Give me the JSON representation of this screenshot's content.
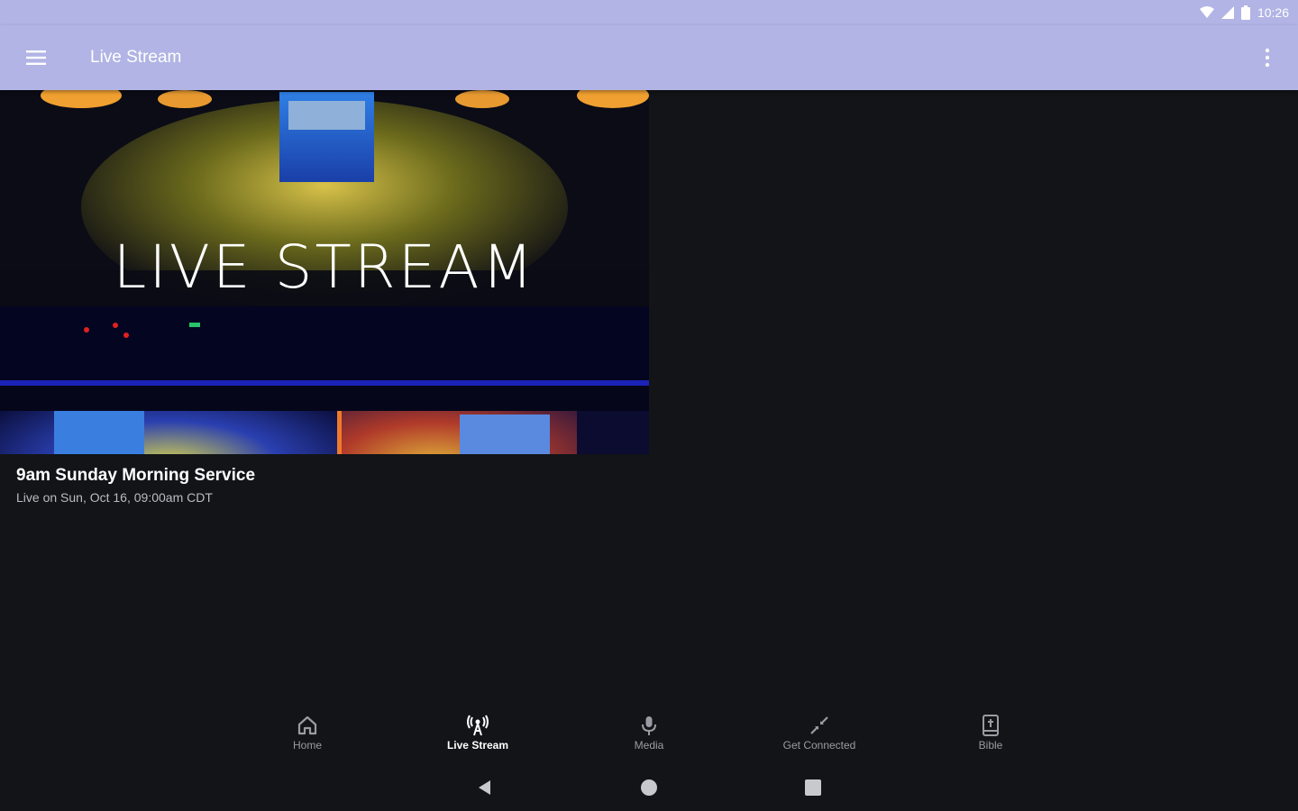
{
  "status_bar": {
    "time": "10:26",
    "icons": [
      "wifi-icon",
      "signal-icon",
      "battery-icon"
    ]
  },
  "app_bar": {
    "title": "Live Stream",
    "icons": [
      "menu-icon",
      "more-vert-icon"
    ],
    "background": "#b1b4e4"
  },
  "stream": {
    "banner_text": "LIVE STREAM",
    "title": "9am Sunday Morning Service",
    "subtitle": "Live on Sun, Oct 16, 09:00am CDT"
  },
  "bottom_nav": {
    "items": [
      {
        "label": "Home",
        "icon": "home-icon",
        "active": false
      },
      {
        "label": "Live Stream",
        "icon": "live-stream-icon",
        "active": true
      },
      {
        "label": "Media",
        "icon": "microphone-icon",
        "active": false
      },
      {
        "label": "Get Connected",
        "icon": "connect-icon",
        "active": false
      },
      {
        "label": "Bible",
        "icon": "bible-icon",
        "active": false
      }
    ]
  },
  "system_nav": {
    "icons": [
      "back-icon",
      "home-circle-icon",
      "recents-icon"
    ]
  },
  "colors": {
    "background": "#121417",
    "accent": "#b1b4e4",
    "inactive_label": "#9a9ca3"
  }
}
